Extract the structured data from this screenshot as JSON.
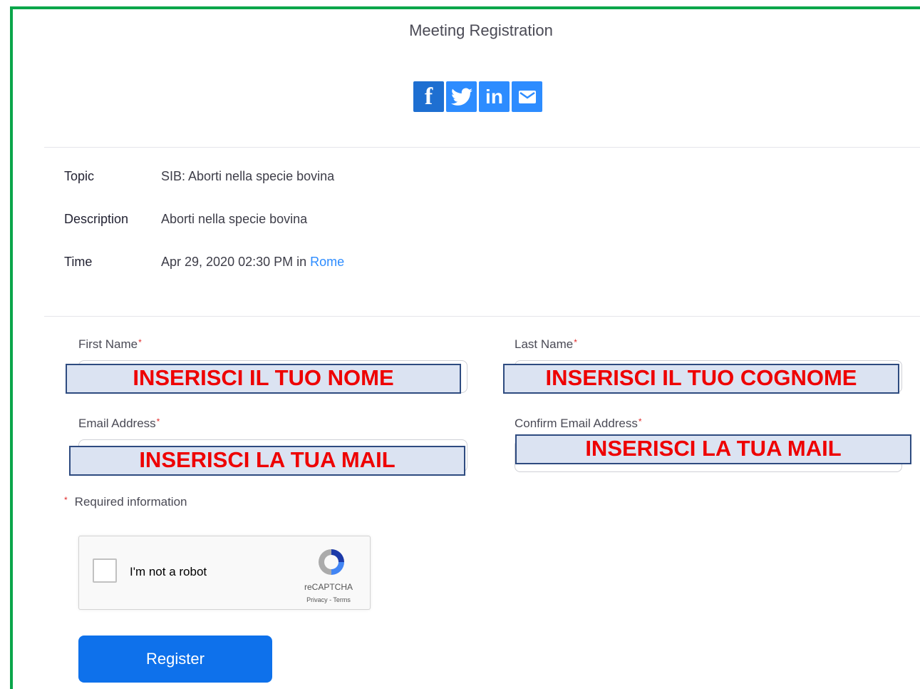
{
  "header": {
    "title": "Meeting Registration"
  },
  "share": {
    "facebook": "f",
    "linkedin": "in"
  },
  "info": {
    "topic_label": "Topic",
    "topic_value": "SIB: Aborti nella specie bovina",
    "description_label": "Description",
    "description_value": "Aborti nella specie bovina",
    "time_label": "Time",
    "time_value": "Apr 29, 2020 02:30 PM in",
    "time_zone_link": "Rome"
  },
  "form": {
    "first_name_label": "First Name",
    "last_name_label": "Last Name",
    "email_label": "Email Address",
    "confirm_email_label": "Confirm Email Address",
    "required_star": "*",
    "required_note": "Required information"
  },
  "overlays": {
    "first_name": "INSERISCI IL TUO NOME",
    "last_name": "INSERISCI IL TUO COGNOME",
    "email": "INSERISCI LA TUA MAIL",
    "confirm_email": "INSERISCI LA TUA MAIL"
  },
  "recaptcha": {
    "label": "I'm not a robot",
    "brand": "reCAPTCHA",
    "terms": "Privacy - Terms"
  },
  "actions": {
    "register_label": "Register"
  },
  "colors": {
    "frame": "#0aa64a",
    "accent": "#0e71eb",
    "overlay_text": "#ee0000",
    "required": "#e02828"
  }
}
